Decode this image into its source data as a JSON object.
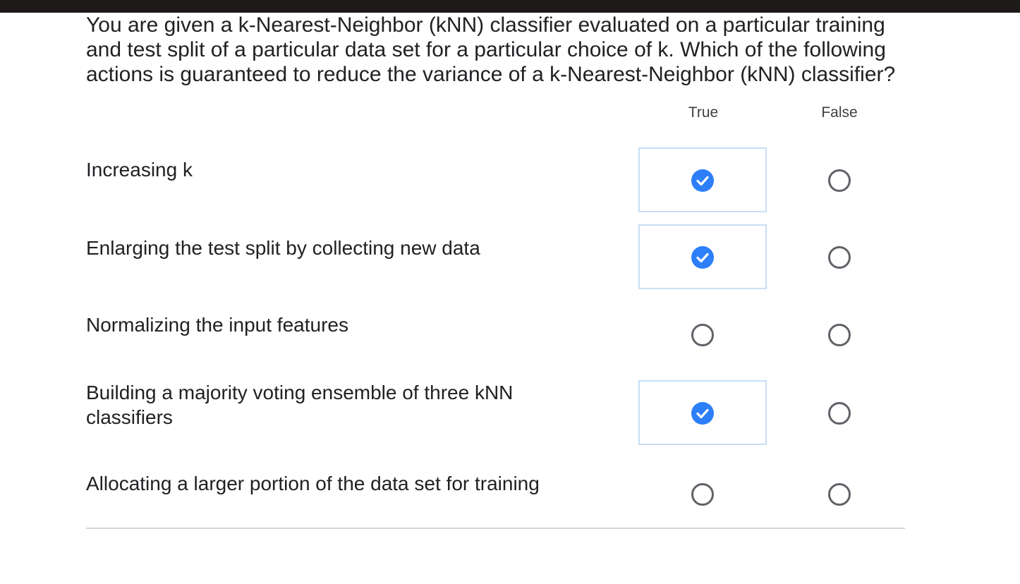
{
  "question": {
    "line1": "You are given a k-Nearest-Neighbor (kNN) classifier evaluated on a particular training",
    "line2": "and test split of a particular data set for a particular choice of k. Which of the following",
    "line3": "actions is guaranteed to reduce the variance of a k-Nearest-Neighbor (kNN) classifier?"
  },
  "columns": [
    "True",
    "False"
  ],
  "rows": [
    {
      "label_lines": [
        "Increasing k"
      ],
      "selected": "True"
    },
    {
      "label_lines": [
        "Enlarging the test split by collecting new data"
      ],
      "selected": "True"
    },
    {
      "label_lines": [
        "Normalizing the input features"
      ],
      "selected": null
    },
    {
      "label_lines": [
        "Building a majority voting ensemble of three kNN",
        "classifiers"
      ],
      "selected": "True"
    },
    {
      "label_lines": [
        "Allocating a larger portion of the data set for training"
      ],
      "selected": null
    }
  ],
  "colors": {
    "selected_radio": "#2d7ff9",
    "selected_cell_border": "#c6def5",
    "unselected_radio_border": "#5f6368",
    "top_bar": "#1f1a1a"
  },
  "icons": {
    "selected": "check-circle-icon",
    "unselected": "empty-radio-icon"
  }
}
